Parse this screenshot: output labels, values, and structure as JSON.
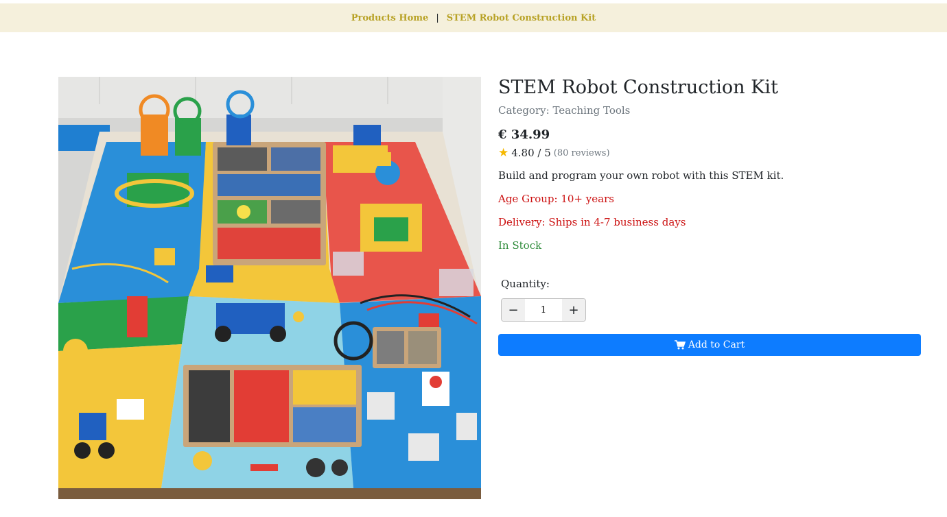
{
  "breadcrumb": {
    "home_label": "Products Home",
    "separator": "|",
    "current_label": "STEM Robot Construction Kit"
  },
  "product": {
    "title": "STEM Robot Construction Kit",
    "category_prefix": "Category:",
    "category": "Teaching Tools",
    "price": "€ 34.99",
    "rating": "4.80 / 5",
    "reviews": "(80 reviews)",
    "description": "Build and program your own robot with this STEM kit.",
    "age_group": "Age Group: 10+ years",
    "delivery": "Delivery: Ships in 4-7 business days",
    "stock": "In Stock",
    "star_icon": "star-icon"
  },
  "purchase": {
    "quantity_label": "Quantity:",
    "quantity_value": "1",
    "decrement_symbol": "−",
    "increment_symbol": "+",
    "add_to_cart_label": "Add to Cart",
    "cart_icon": "shopping-cart-icon"
  },
  "colors": {
    "breadcrumb_bg": "#f5f0dc",
    "breadcrumb_link": "#b8a226",
    "alert_red": "#cc1111",
    "stock_green": "#2e8b3a",
    "primary_button": "#0d7cff",
    "star": "#f5b800"
  }
}
